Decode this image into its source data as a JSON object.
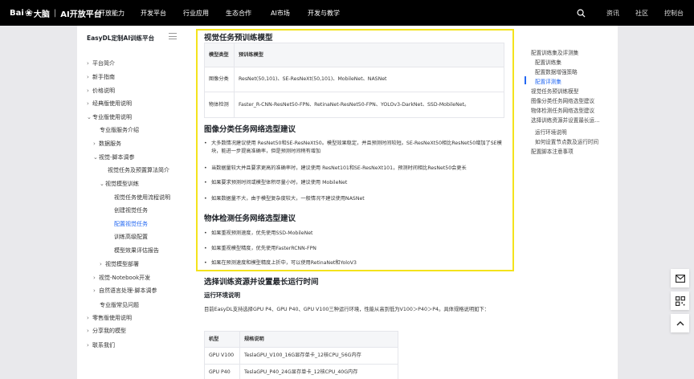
{
  "topbar": {
    "logo_brand": "Bai",
    "logo_mid": "大脑",
    "logo_sep": "|",
    "logo_platform": "AI开放平台",
    "nav": [
      "开放能力",
      "开发平台",
      "行业应用",
      "生态合作",
      "AI市场",
      "开发与教学"
    ],
    "right_links": [
      "资讯",
      "社区",
      "控制台"
    ]
  },
  "sidebar": {
    "title": "EasyDL定制AI训练平台",
    "items": [
      {
        "label": "平台简介",
        "arrow": "›"
      },
      {
        "label": "新手指南",
        "arrow": "›"
      },
      {
        "label": "价格说明",
        "arrow": "›"
      },
      {
        "label": "经典版使用说明",
        "arrow": "›"
      },
      {
        "label": "专业版使用说明",
        "arrow": "⌄"
      },
      {
        "label": "专业版服务介绍",
        "arrow": ""
      },
      {
        "label": "数据服务",
        "arrow": "›"
      },
      {
        "label": "视觉-脚本调参",
        "arrow": "⌄"
      },
      {
        "label": "视觉任务及预置算法简介",
        "arrow": ""
      },
      {
        "label": "视觉模型训练",
        "arrow": "⌄"
      },
      {
        "label": "视觉任务使用流程说明",
        "arrow": ""
      },
      {
        "label": "创建视觉任务",
        "arrow": ""
      },
      {
        "label": "配置视觉任务",
        "arrow": ""
      },
      {
        "label": "训练高级配置",
        "arrow": ""
      },
      {
        "label": "模型效果评估报告",
        "arrow": ""
      },
      {
        "label": "视觉模型部署",
        "arrow": "›"
      },
      {
        "label": "视觉-Notebook开发",
        "arrow": "›"
      },
      {
        "label": "自然语言处理-脚本调参",
        "arrow": "›"
      },
      {
        "label": "专业版常见问题",
        "arrow": ""
      },
      {
        "label": "零售版使用说明",
        "arrow": "›"
      },
      {
        "label": "分享我的模型",
        "arrow": "›"
      },
      {
        "label": "联系我们",
        "arrow": "›"
      }
    ]
  },
  "content": {
    "h_pretrain": "视觉任务预训练模型",
    "table1": {
      "headers": [
        "模型类型",
        "预训练模型"
      ],
      "rows": [
        [
          "图像分类",
          "ResNet(50,101)、SE-ResNeXt(50,101)、MobileNet、NASNet"
        ],
        [
          "物体检测",
          "Faster_R-CNN-ResNet50-FPN、RetinaNet-ResNet50-FPN、YOLOv3-DarkNet、SSD-MobileNet。"
        ]
      ]
    },
    "h_cls": "图像分类任务网络选型建议",
    "cls_bullets": [
      "大多数情况建议使用 ResNet50和SE-ResNeXt50。模型效果稳定，并且预测时间较短。SE-ResNeXt50相比ResNet50增加了SE模块，能进一步提高准确率，但是预测时间稍有增加",
      "当数据量较大并且要求更高的准确率时，建议使用 ResNet101和SE-ResNeXt101，预测时间相比ResNet50会更长",
      "如果要求预测时间或模型体积尽量小时，建议使用 MobileNet",
      "如果数据量不大，由于模型复杂度较大，一般情况不建议使用NASNet"
    ],
    "h_det": "物体检测任务网络选型建议",
    "det_bullets": [
      "如果重视预测速度，优先使用SSD-MobileNet",
      "如果重视模型精度，优先使用FasterRCNN-FPN",
      "如果在预测速度和模型精度上折中，可以使用RetinaNet和YoloV3"
    ],
    "h_resource": "选择训练资源并设置最长运行时间",
    "h_env": "运行环境说明",
    "env_para": "目前EasyDL支持选择GPU P4、GPU P40、GPU V100三种运行环境，性能从高到低为V100＞P40＞P4。具体规格说明如下：",
    "table2": {
      "headers": [
        "机型",
        "规格说明"
      ],
      "rows": [
        [
          "GPU V100",
          "TeslaGPU_V100_16G显存单卡_12核CPU_56G内存"
        ],
        [
          "GPU P40",
          "TeslaGPU_P40_24G显存单卡_12核CPU_40G内存"
        ]
      ]
    }
  },
  "toc": {
    "items": [
      "配置训练集及评测集",
      "配置训练集",
      "配置数据增强策略",
      "配置评测集",
      "视觉任务预训练模型",
      "图像分类任务网络选型建议",
      "物体检测任务网络选型建议",
      "选择训练资源并设置最长运...",
      "如何设置节点数及运行时间",
      "配置脚本注意事项"
    ],
    "sub_items": [
      "运行环境说明"
    ]
  },
  "colors": {
    "accent": "#2468f2",
    "highlight": "#f4e31c",
    "topbar": "#000000"
  }
}
